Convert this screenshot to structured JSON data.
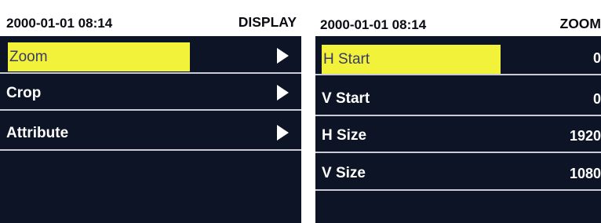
{
  "left_panel": {
    "time": "2000-01-01 08:14",
    "title": "DISPLAY",
    "items": [
      {
        "label": "Zoom"
      },
      {
        "label": "Crop"
      },
      {
        "label": "Attribute"
      }
    ]
  },
  "right_panel": {
    "time": "2000-01-01 08:14",
    "title": "ZOOM",
    "items": [
      {
        "label": "H Start",
        "value": "0"
      },
      {
        "label": "V Start",
        "value": "0"
      },
      {
        "label": "H Size",
        "value": "1920"
      },
      {
        "label": "V Size",
        "value": "1080"
      }
    ]
  },
  "colors": {
    "screen_bg": "#0d1426",
    "header_bg": "#ffffff",
    "highlight": "#f2f23a",
    "text": "#ffffff",
    "divider": "#c9ccd6"
  },
  "icons": {
    "submenu_arrow": "play-triangle-right-icon"
  }
}
